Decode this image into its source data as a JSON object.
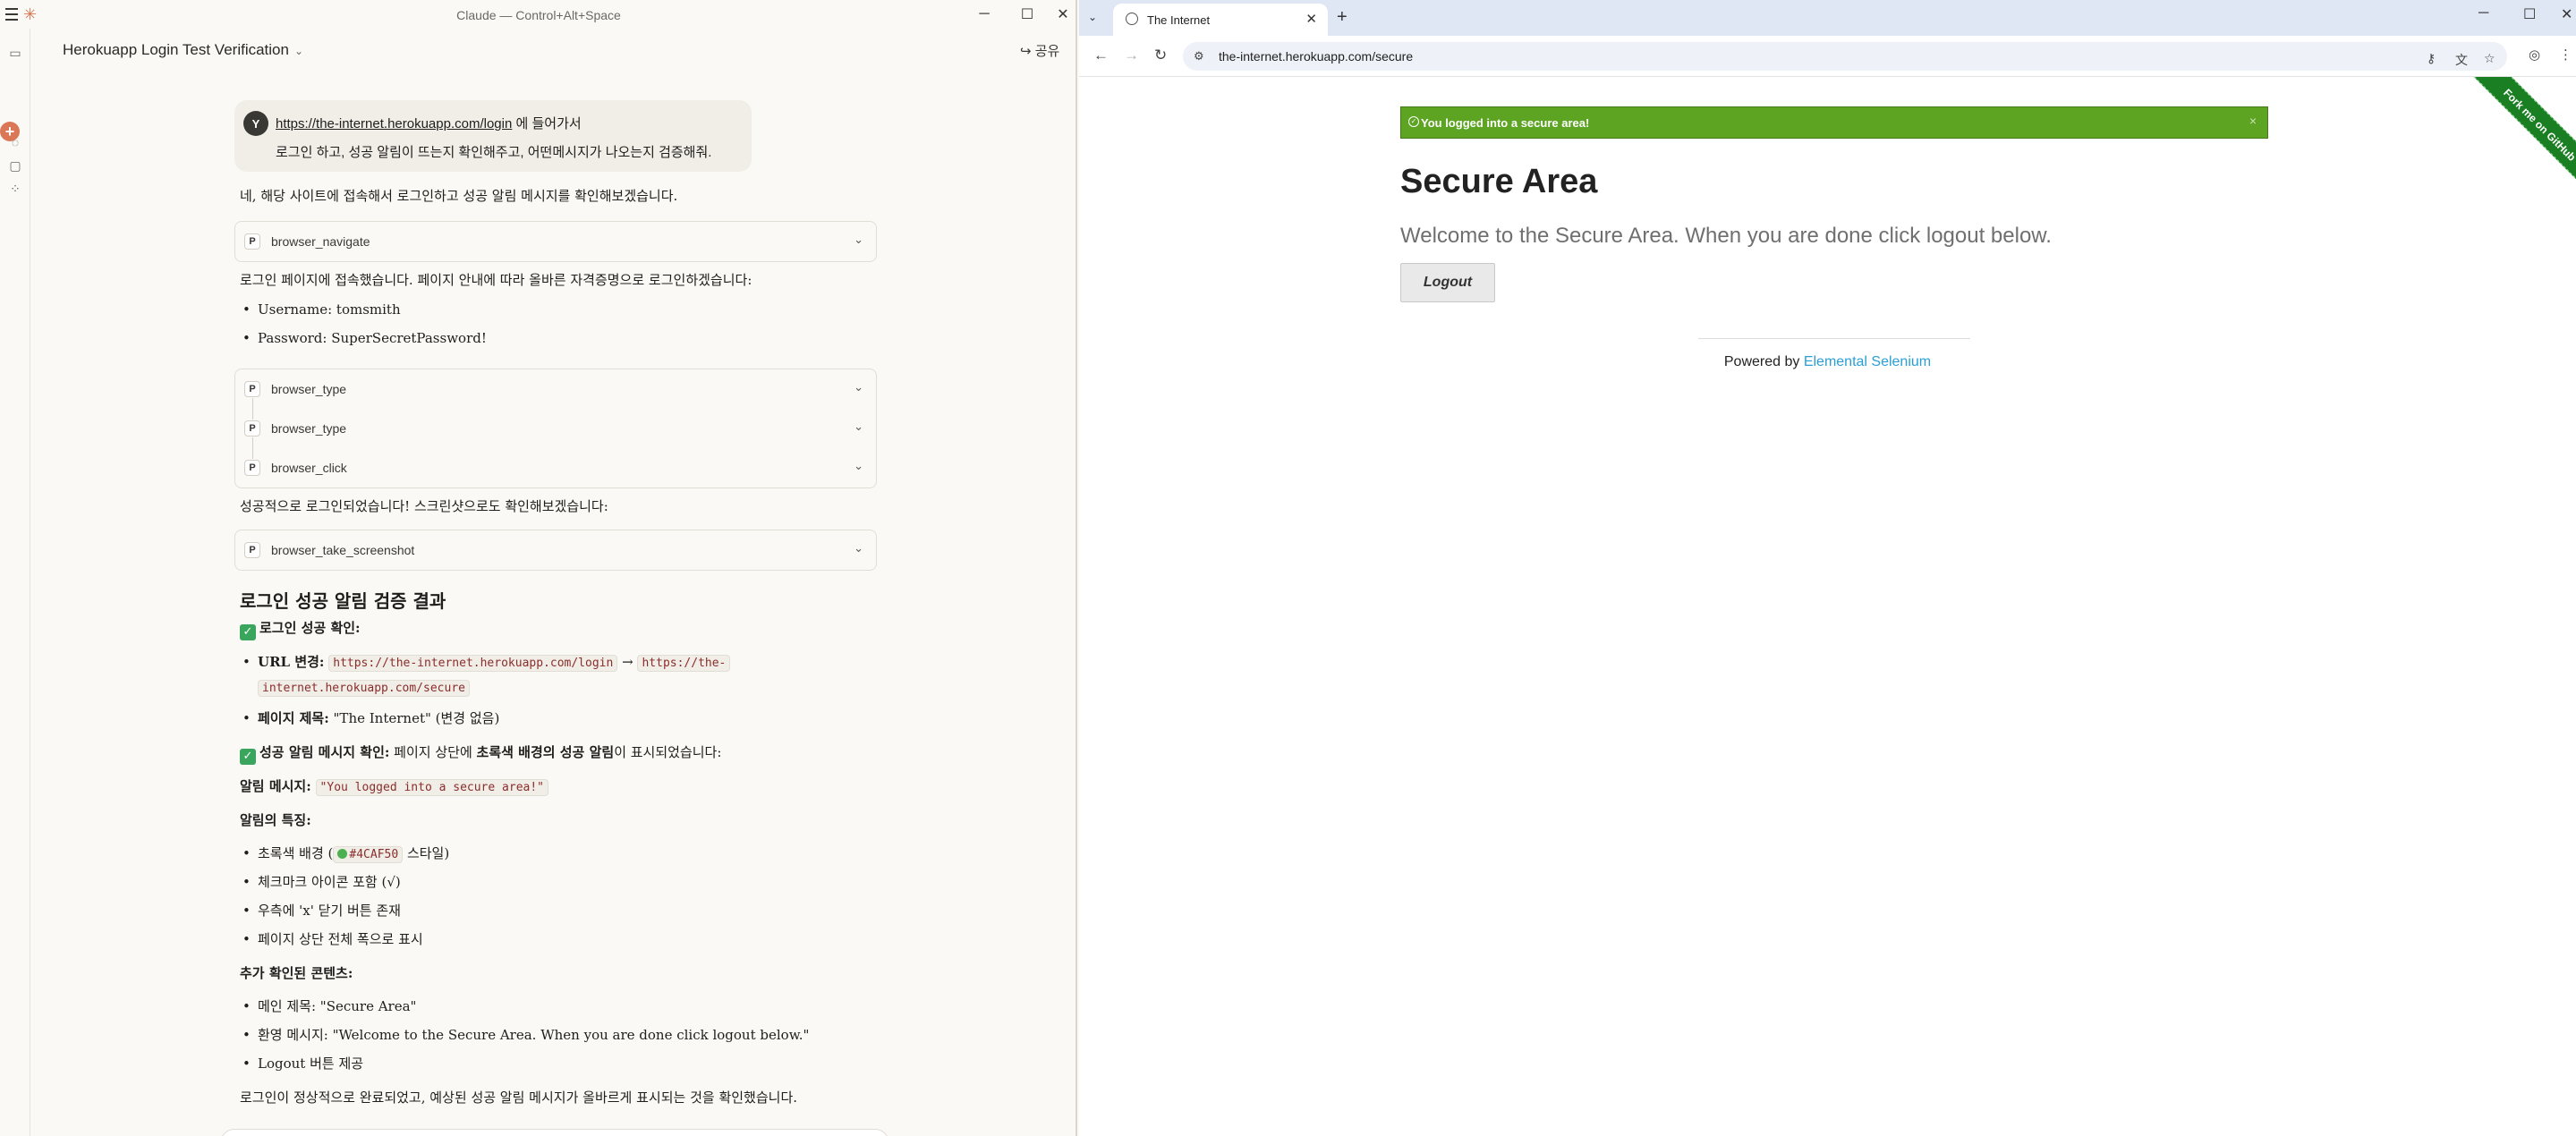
{
  "claude": {
    "window_title": "Claude — Control+Alt+Space",
    "conversation_title": "Herokuapp Login Test Verification",
    "share_label": "공유",
    "user_avatar": "Y",
    "user_link": "https://the-internet.herokuapp.com/login",
    "user_line1_rest": " 에 들어가서",
    "user_line2": "로그인 하고, 성공 알림이 뜨는지 확인해주고, 어떤메시지가 나오는지 검증해줘.",
    "reply_intro": "네, 해당 사이트에 접속해서 로그인하고 성공 알림 메시지를 확인해보겠습니다.",
    "tool_navigate": "browser_navigate",
    "after_nav": "로그인 페이지에 접속했습니다. 페이지 안내에 따라 올바른 자격증명으로 로그인하겠습니다:",
    "cred_username": "Username: tomsmith",
    "cred_password": "Password: SuperSecretPassword!",
    "tools_group": [
      "browser_type",
      "browser_type",
      "browser_click"
    ],
    "after_login": "성공적으로 로그인되었습니다! 스크린샷으로도 확인해보겠습니다:",
    "tool_screenshot": "browser_take_screenshot",
    "result_heading": "로그인 성공 알림 검증 결과",
    "login_confirm": "로그인 성공 확인:",
    "url_change_label": "URL 변경:",
    "url_from": "https://the-internet.herokuapp.com/login",
    "arrow": "→",
    "url_to_part1": "https://the-",
    "url_to_part2": "internet.herokuapp.com/secure",
    "page_title_label": "페이지 제목:",
    "page_title_value": " \"The Internet\" (변경 없음)",
    "alert_confirm_label": "성공 알림 메시지 확인:",
    "alert_confirm_rest1": " 페이지 상단에 ",
    "alert_confirm_bold": "초록색 배경의 성공 알림",
    "alert_confirm_rest2": "이 표시되었습니다:",
    "alert_msg_label": "알림 메시지:",
    "alert_msg_value": "\"You logged into a secure area!\"",
    "features_label": "알림의 특징:",
    "feature1_a": "초록색 배경 (",
    "feature1_code": "#4CAF50",
    "feature1_b": " 스타일)",
    "feature2": "체크마크 아이콘 포함 (√)",
    "feature3": "우측에 'x' 닫기 버튼 존재",
    "feature4": "페이지 상단 전체 폭으로 표시",
    "extra_label": "추가 확인된 콘텐츠:",
    "extra1": "메인 제목: \"Secure Area\"",
    "extra2": "환영 메시지: \"Welcome to the Secure Area. When you are done click logout below.\"",
    "extra3": "Logout 버튼 제공",
    "conclusion": "로그인이 정상적으로 완료되었고, 예상된 성공 알림 메시지가 올바르게 표시되는 것을 확인했습니다."
  },
  "chrome": {
    "tab_title": "The Internet",
    "url": "the-internet.herokuapp.com/secure",
    "page": {
      "flash_message": "You logged into a secure area!",
      "flash_close": "×",
      "heading": "Secure Area",
      "subheading": "Welcome to the Secure Area. When you are done click logout below.",
      "logout_label": "Logout",
      "footer_prefix": "Powered by ",
      "footer_link": "Elemental Selenium",
      "fork_ribbon": "Fork me on GitHub"
    }
  },
  "colors": {
    "claude_accent": "#d97757",
    "flash_green": "#5da423",
    "ribbon_green": "#1a7f22",
    "link_blue": "#2a9fd6"
  }
}
